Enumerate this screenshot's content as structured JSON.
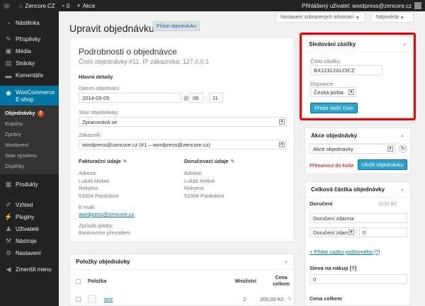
{
  "adminbar": {
    "wp_icon": "wordpress-icon",
    "site_name": "Zencore.CZ",
    "comments_count": "0",
    "new_label": "Akce",
    "user_text": "Přihlášený uživatel: wordpress@zencore.cz"
  },
  "sidebar": {
    "dashboard": "Nástěnka",
    "posts": "Příspěvky",
    "media": "Média",
    "pages": "Stránky",
    "comments": "Komentáře",
    "woocommerce": "WooCommerce E-shop",
    "sub": {
      "orders": "Objednávky",
      "orders_count": "2",
      "coupons": "Kupóny",
      "reports": "Zprávy",
      "settings": "Nastavení",
      "status": "Stav systému",
      "addons": "Doplňky"
    },
    "products": "Produkty",
    "appearance": "Vzhled",
    "plugins": "Pluginy",
    "users": "Uživatelé",
    "tools": "Nástroje",
    "settings": "Nastavení",
    "collapse": "Zmenšit menu"
  },
  "screen_options": "Nastavení zobrazených informací",
  "help": "Nápověda",
  "page": {
    "title": "Upravit objednávku",
    "add_new": "Přidat objednávku"
  },
  "order": {
    "heading": "Podrobnosti o objednávce",
    "subheading": "Číslo objednávky #11. IP zákazníka: 127.0.0.1",
    "general": "Hlavní detaily",
    "date_label": "Datum objednání:",
    "date_value": "2014-05-05",
    "at": "@",
    "hour": "06",
    "minute": "11",
    "status_label": "Stav objednávky:",
    "status_value": "Zpracovává se",
    "customer_label": "Zákazník:",
    "customer_value": "wordpress@zencore.cz (#1 – wordpress@zencore.cz)",
    "billing_title": "Fakturační údaje",
    "shipping_title": "Doručovací údaje",
    "billing": {
      "address_label": "Adresa:",
      "name": "Lukáš Hošek",
      "street": "Rokytno",
      "city": "53304 Pardubice",
      "email_label": "E-mail:",
      "email": "wordpress@zencore.cz",
      "payment_label": "Způsob platby:",
      "payment": "Bankovním převodem"
    },
    "shipping": {
      "address_label": "Adresa:",
      "name": "Lukáš Hošek",
      "street": "Rokytno",
      "city": "53304 Pardubice"
    }
  },
  "items": {
    "heading": "Položky objednávky",
    "col_item": "Položka",
    "col_qty": "Množství",
    "col_total": "Cena celkem",
    "rows": [
      {
        "name": "test",
        "qty": "2",
        "total": "200,00 Kč"
      }
    ]
  },
  "tracking": {
    "heading": "Sledování zásilky",
    "number_label": "Číslo zásilky:",
    "number_value": "BX123123123CZ",
    "carrier_label": "Dopravce:",
    "carrier_value": "Česká pošta",
    "add_button": "Přidat další číslo"
  },
  "actions": {
    "heading": "Akce objednávky",
    "select_value": "Akce objednávky",
    "trash": "Přesunout do koše",
    "save": "Uložit objednávku"
  },
  "totals": {
    "heading": "Celková částka objednávky",
    "shipping_label": "Doručení",
    "shipping_value": "0,00 Kč",
    "shipping_name": "Doručení zdarma",
    "shipping_method": "Doručení zdarı",
    "shipping_cost": "0",
    "add_shipping": "+ Přidat sazbu poštovného [?]",
    "discount_label": "Sleva na nákup [?]",
    "discount_value": "0",
    "total_label": "Cena celkem"
  },
  "colors": {
    "accent": "#0074a2",
    "button": "#2ea2cc",
    "highlight_frame": "#e00000",
    "trash": "#a00"
  }
}
